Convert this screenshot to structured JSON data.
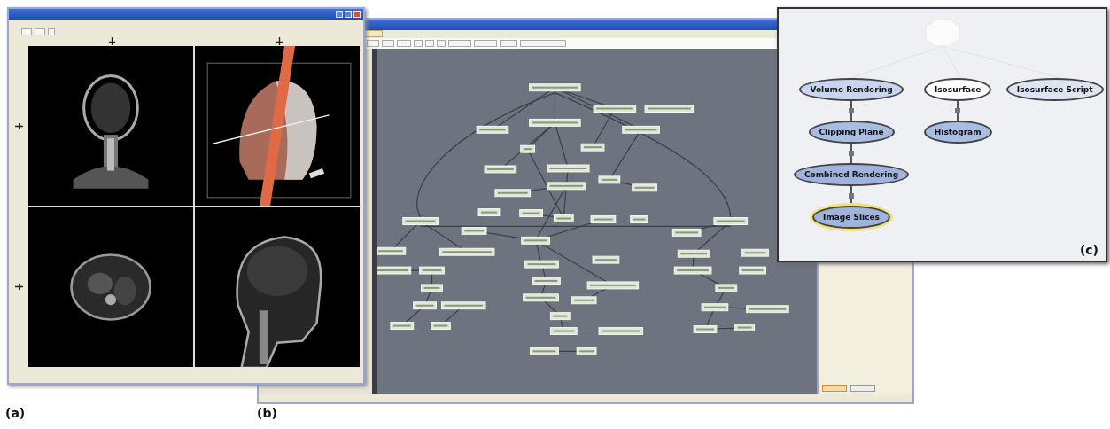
{
  "window_a": {
    "label": "(a)"
  },
  "window_b": {
    "label": "(b)",
    "side_tabs": [
      {
        "selected": true
      },
      {
        "selected": false
      }
    ]
  },
  "panel_c": {
    "label": "(c)",
    "nodes": [
      {
        "label": "Volume Rendering",
        "color": "#c9d5ee",
        "selected": false,
        "children": [
          {
            "label": "Clipping Plane",
            "color": "#a9bde3",
            "selected": false,
            "children": [
              {
                "label": "Combined Rendering",
                "color": "#9fb3dc",
                "selected": false,
                "children": [
                  {
                    "label": "Image Slices",
                    "color": "#9fb3dc",
                    "selected": true
                  }
                ]
              }
            ]
          }
        ]
      },
      {
        "label": "Isosurface",
        "color": "#ffffff",
        "selected": false,
        "children": [
          {
            "label": "Histogram",
            "color": "#a9bde3",
            "selected": false
          }
        ]
      },
      {
        "label": "Isosurface Script",
        "color": "#dde4f2",
        "selected": false
      }
    ]
  }
}
